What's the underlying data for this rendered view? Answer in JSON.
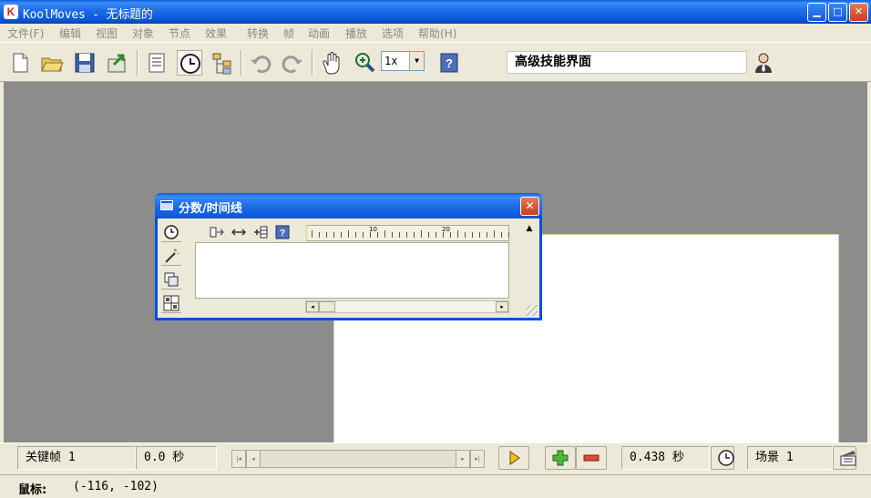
{
  "window": {
    "app_logo": "K",
    "title": "KoolMoves - 无标题的",
    "minimize_label": "▁",
    "maximize_label": "□",
    "close_label": "✕"
  },
  "menu": [
    "文件(F)",
    "编辑",
    "视图",
    "对象",
    "节点",
    "效果",
    "转换",
    "帧",
    "动画",
    "播放",
    "选项",
    "帮助(H)"
  ],
  "toolbar": {
    "zoom_value": "1x",
    "mode_label": "高级技能界面",
    "icons": [
      "new-file-icon",
      "open-folder-icon",
      "save-disk-icon",
      "export-icon",
      "list-icon",
      "clock-icon",
      "tree-icon",
      "undo-icon",
      "redo-icon",
      "hand-icon",
      "zoom-icon",
      "help-icon",
      "user-icon"
    ]
  },
  "timeline": {
    "title": "分数/时间线",
    "close_label": "✕",
    "ruler_labels": [
      "10",
      "20"
    ],
    "scroll_left": "◂",
    "scroll_right": "▸",
    "scroll_up": "▲"
  },
  "bottom": {
    "keyframe": "关键帧 1",
    "time": "0.0 秒",
    "slider_start": "|◂",
    "slider_prev": "◂",
    "slider_next": "▸",
    "slider_end": "▸|",
    "duration": "0.438 秒",
    "scene": "场景 1"
  },
  "status": {
    "label": "鼠标:",
    "coords": "(-116, -102)"
  },
  "colors": {
    "title_blue": "#0a56d8",
    "workspace_gray": "#8c8c8c",
    "stage_white": "#ffffff",
    "chrome": "#ece9d8",
    "close_red": "#c9401d"
  }
}
